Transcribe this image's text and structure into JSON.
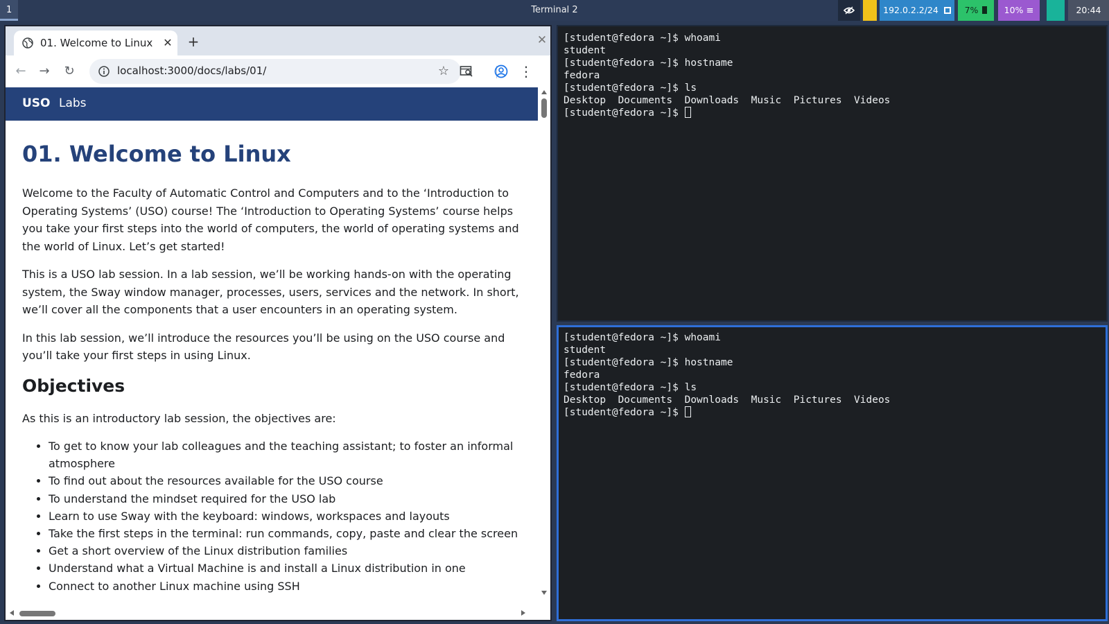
{
  "topbar": {
    "workspace": "1",
    "title": "Terminal 2",
    "network": "192.0.2.2/24",
    "battery": "7%",
    "cpu": "10%",
    "time": "20:44",
    "colors": {
      "bar": "#2c3b57",
      "network": "#2f86c9",
      "battery": "#2cc26a",
      "cpu": "#9b59d0",
      "teal": "#19b39a",
      "yellow": "#f2c21a"
    }
  },
  "browser": {
    "tab": {
      "title": "01. Welcome to Linux",
      "icon": "globe-icon"
    },
    "url": "localhost:3000/docs/labs/01/",
    "site": {
      "brand": "USO",
      "nav_link": "Labs"
    },
    "article": {
      "title": "01. Welcome to Linux",
      "paragraphs": [
        "Welcome to the Faculty of Automatic Control and Computers and to the ‘Introduction to Operating Systems’ (USO) course! The ‘Introduction to Operating Systems’ course helps you take your first steps into the world of computers, the world of operating systems and the world of Linux. Let’s get started!",
        "This is a USO lab session. In a lab session, we’ll be working hands-on with the operating system, the Sway window manager, processes, users, services and the network. In short, we’ll cover all the components that a user encounters in an operating system.",
        "In this lab session, we’ll introduce the resources you’ll be using on the USO course and you’ll take your first steps in using Linux."
      ],
      "objectives_heading": "Objectives",
      "objectives_intro": "As this is an introductory lab session, the objectives are:",
      "objectives": [
        "To get to know your lab colleagues and the teaching assistant; to foster an informal atmosphere",
        "To find out about the resources available for the USO course",
        "To understand the mindset required for the USO lab",
        "Learn to use Sway with the keyboard: windows, workspaces and layouts",
        "Take the first steps in the terminal: run commands, copy, paste and clear the screen",
        "Get a short overview of the Linux distribution families",
        "Understand what a Virtual Machine is and install a Linux distribution in one",
        "Connect to another Linux machine using SSH"
      ]
    }
  },
  "terminals": {
    "prompt": "[student@fedora ~]$ ",
    "lines": [
      "[student@fedora ~]$ whoami",
      "student",
      "[student@fedora ~]$ hostname",
      "fedora",
      "[student@fedora ~]$ ls",
      "Desktop  Documents  Downloads  Music  Pictures  Videos"
    ]
  }
}
